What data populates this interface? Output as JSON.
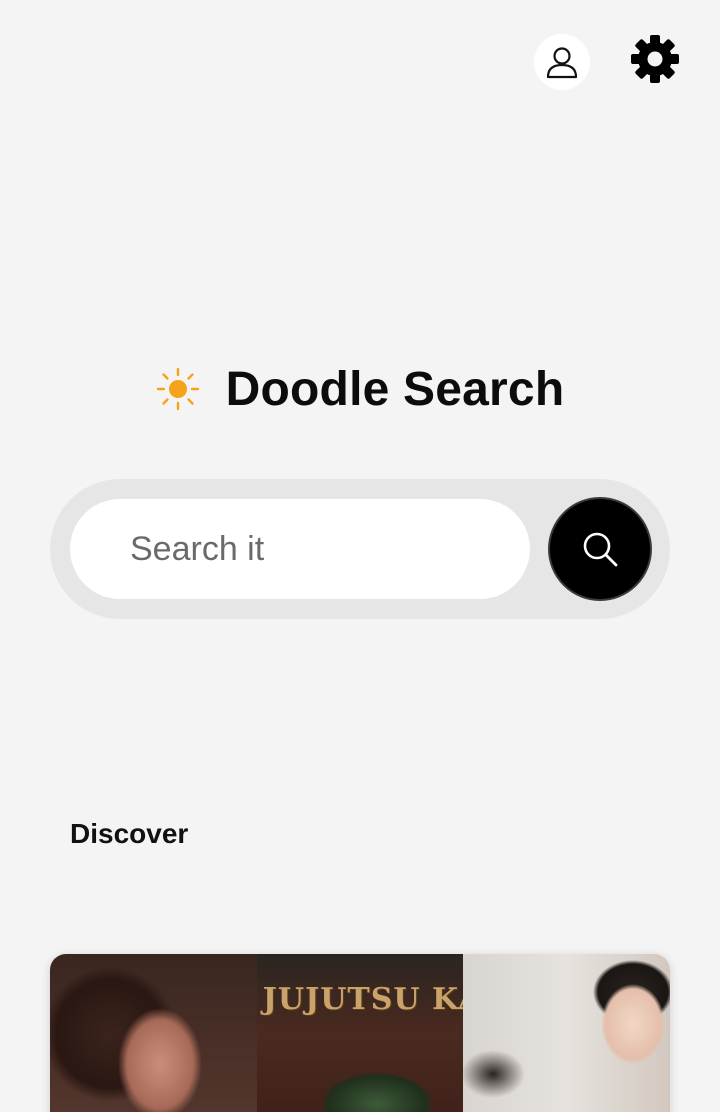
{
  "header": {
    "profile_icon": "person-outline-icon",
    "settings_icon": "gear-icon"
  },
  "brand": {
    "icon": "sun-icon",
    "icon_color": "#f5a31a",
    "title": "Doodle Search"
  },
  "search": {
    "placeholder": "Search it",
    "value": "",
    "button_icon": "search-icon"
  },
  "discover": {
    "title": "Discover",
    "items": [
      {
        "title": ""
      },
      {
        "title": "JUJUTSU KAISEN"
      },
      {
        "title": ""
      }
    ]
  },
  "colors": {
    "background": "#f4f4f4",
    "search_track": "#e6e6e6",
    "search_button": "#000000",
    "accent_sun": "#f5a31a"
  }
}
